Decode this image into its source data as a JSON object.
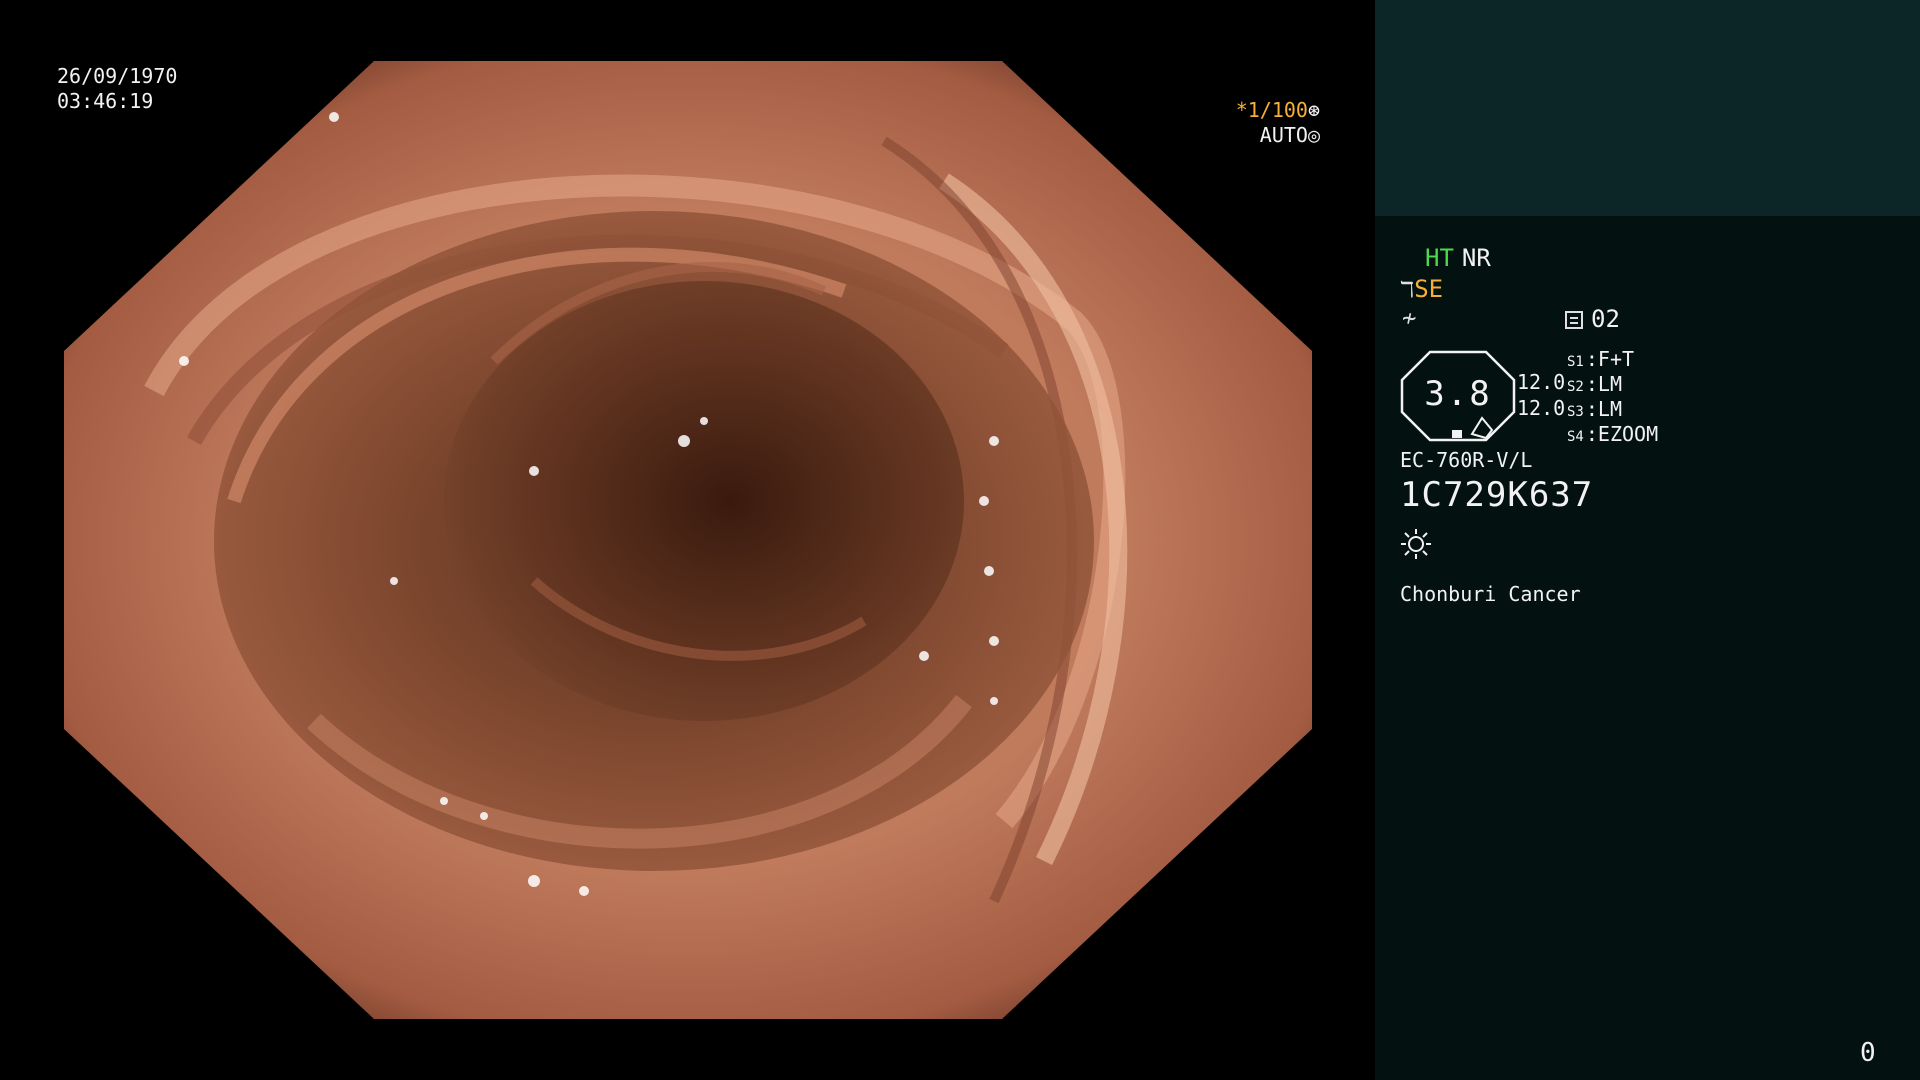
{
  "osd": {
    "date": "26/09/1970",
    "time": "03:46:19",
    "shutter": "*1/100",
    "shutter_icon": "shutter-icon",
    "iris": "AUTO",
    "iris_icon": "iris-icon"
  },
  "panel": {
    "mode_ht": "HT",
    "mode_nr": "NR",
    "se_label": "SE",
    "memory_label": "02",
    "gauge_value": "3.8",
    "gauge_top": "12.0",
    "gauge_bottom": "12.0",
    "switches": [
      {
        "key": "S1",
        "value": "F+T"
      },
      {
        "key": "S2",
        "value": "LM"
      },
      {
        "key": "S3",
        "value": "LM"
      },
      {
        "key": "S4",
        "value": "EZOOM"
      }
    ],
    "scope_model": "EC-760R-V/L",
    "scope_serial": "1C729K637",
    "institution": "Chonburi Cancer",
    "counter": "0"
  },
  "colors": {
    "panel_bg": "#031210",
    "patient_box_bg": "#0c2526",
    "ht_green": "#4ed84e",
    "accent_orange": "#f5b03a"
  }
}
